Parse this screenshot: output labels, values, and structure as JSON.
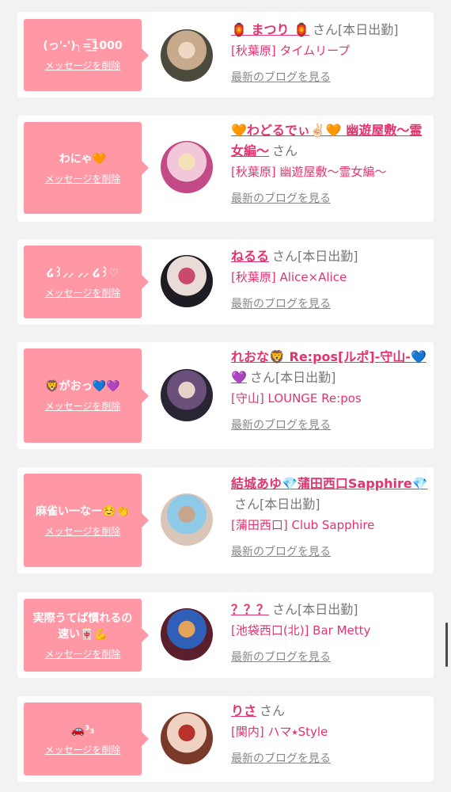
{
  "favorites": [
    {
      "message": "(っ'-')╮=͟͟͞͞1000",
      "delete_label": "メッセージを削除",
      "name": "🏮 まつり 🏮",
      "san": "さん",
      "status": "[本日出勤]",
      "shop": "[秋葉原] タイムリープ",
      "blog_label": "最新のブログを見る",
      "avatar_colors": [
        "#4b4a3c",
        "#c7a98b",
        "#f0d7c4"
      ]
    },
    {
      "message": "わにゃ🧡",
      "delete_label": "メッセージを削除",
      "name": "🧡わどるでぃ✌🏻🧡 幽遊屋敷〜霊女編〜",
      "san": "さん",
      "status": "",
      "shop": "[秋葉原] 幽遊屋敷〜霊女編〜",
      "blog_label": "最新のブログを見る",
      "avatar_colors": [
        "#c24a86",
        "#f1c7d9",
        "#f5e1b8"
      ]
    },
    {
      "message": "໒꒱⸝⸝ ⸝⸝ ໒꒱♡",
      "delete_label": "メッセージを削除",
      "name": "ねるる",
      "san": "さん",
      "status": "[本日出勤]",
      "shop": "[秋葉原] Alice×Alice",
      "blog_label": "最新のブログを見る",
      "avatar_colors": [
        "#1e1b22",
        "#e9dcd6",
        "#c94a6a"
      ]
    },
    {
      "message": "🦁がおっ💙💜",
      "delete_label": "メッセージを削除",
      "name": "れおな🦁 Re:pos[ルポ]-守山-💙💜",
      "san": "さん",
      "status": "[本日出勤]",
      "shop": "[守山] LOUNGE Re:pos",
      "blog_label": "最新のブログを見る",
      "avatar_colors": [
        "#2a2533",
        "#6a4f7a",
        "#e8d1c8"
      ]
    },
    {
      "message": "麻雀い一なー☺️👏",
      "delete_label": "メッセージを削除",
      "name": "結城あゆ💎蒲田西口Sapphire💎",
      "san": "さん",
      "status": "[本日出勤]",
      "shop": "[蒲田西口] Club Sapphire",
      "blog_label": "最新のブログを見る",
      "avatar_colors": [
        "#d9c6b8",
        "#8fc9e8",
        "#c8a48c"
      ]
    },
    {
      "message": "実際うてば慣れるの速い🀄💪",
      "delete_label": "メッセージを削除",
      "name": "？？？",
      "san": "さん",
      "status": "[本日出勤]",
      "shop": "[池袋西口(北)] Bar Metty",
      "blog_label": "最新のブログを見る",
      "avatar_colors": [
        "#5a1f2a",
        "#2f5fb8",
        "#e3a35a"
      ]
    },
    {
      "message": "🚗³₃",
      "delete_label": "メッセージを削除",
      "name": "りさ",
      "san": "さん",
      "status": "",
      "shop": "[関内] ハマ⭑Style",
      "blog_label": "最新のブログを見る",
      "avatar_colors": [
        "#7a3a2a",
        "#f0d2c2",
        "#b8322c"
      ]
    }
  ]
}
